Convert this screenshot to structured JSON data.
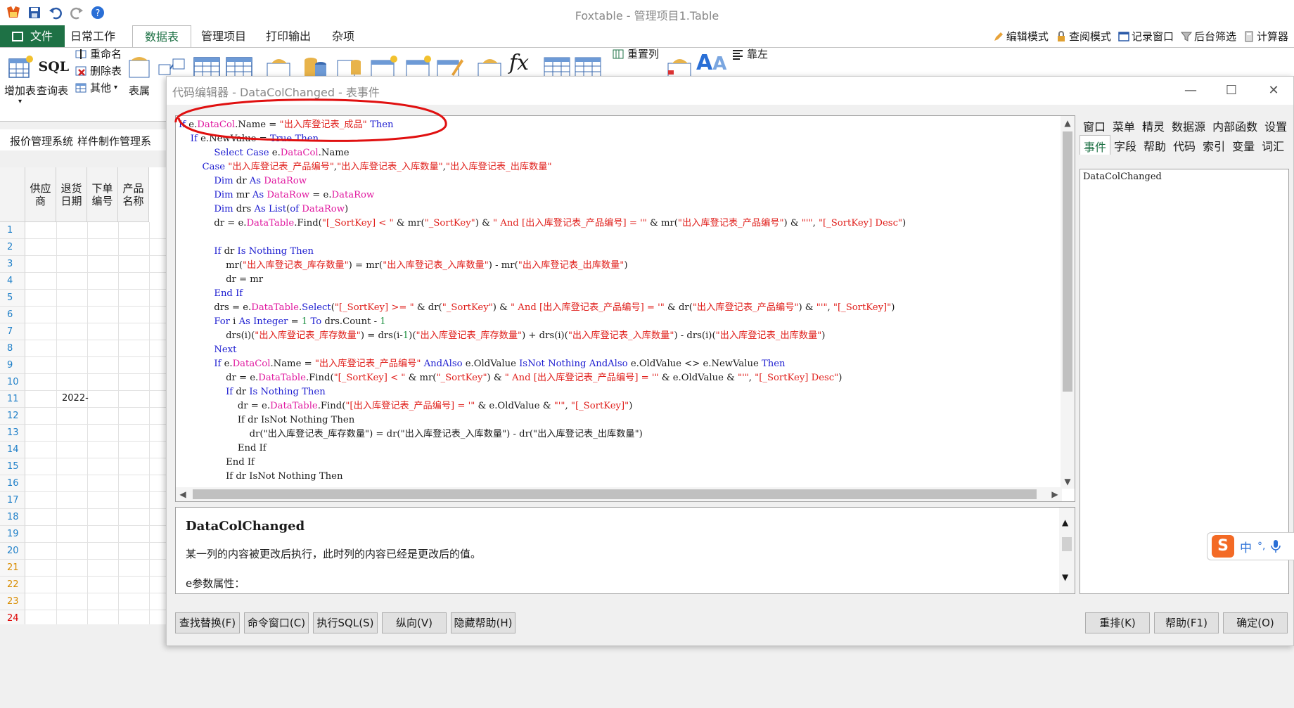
{
  "app": {
    "title": "Foxtable - 管理项目1.Table"
  },
  "ribbon_tabs": [
    "文件",
    "日常工作",
    "数据表",
    "管理项目",
    "打印输出",
    "杂项"
  ],
  "ribbon_right": [
    "编辑模式",
    "查阅模式",
    "记录窗口",
    "后台筛选",
    "计算器"
  ],
  "ribbon": {
    "add_table": "增加表",
    "query_table": "查询表",
    "sql_label": "SQL",
    "rename": "重命名",
    "delete_table": "删除表",
    "other": "其他",
    "table_prop": "表属",
    "rearrange_col": "重置列",
    "align_left": "靠左"
  },
  "sheet_tabs": [
    "报价管理系统",
    "样件制作管理系"
  ],
  "grid": {
    "headers": [
      "供应商",
      "退货日期",
      "下单编号",
      "产品名称"
    ],
    "rows": [
      "1",
      "2",
      "3",
      "4",
      "5",
      "6",
      "7",
      "8",
      "9",
      "10",
      "11",
      "12",
      "13",
      "14",
      "15",
      "16",
      "17",
      "18",
      "19",
      "20",
      "21",
      "22",
      "23",
      "24"
    ],
    "date_cell_row": 11,
    "date_cell_value": "2022-"
  },
  "editor": {
    "title": "代码编辑器 - DataColChanged - 表事件",
    "code_lines": [
      "If e.DataCol.Name = \"出入库登记表_成品\" Then",
      "    If e.NewValue = True Then",
      "            Select Case e.DataCol.Name",
      "        Case \"出入库登记表_产品编号\",\"出入库登记表_入库数量\",\"出入库登记表_出库数量\"",
      "            Dim dr As DataRow",
      "            Dim mr As DataRow = e.DataRow",
      "            Dim drs As List(of DataRow)",
      "            dr = e.DataTable.Find(\"[_SortKey] < \" & mr(\"_SortKey\") & \" And [出入库登记表_产品编号] = '\" & mr(\"出入库登记表_产品编号\") & \"'\", \"[_SortKey] Desc\")",
      "",
      "            If dr Is Nothing Then",
      "                mr(\"出入库登记表_库存数量\") = mr(\"出入库登记表_入库数量\") - mr(\"出入库登记表_出库数量\")",
      "                dr = mr",
      "            End If",
      "            drs = e.DataTable.Select(\"[_SortKey] >= \" & dr(\"_SortKey\") & \" And [出入库登记表_产品编号] = '\" & dr(\"出入库登记表_产品编号\") & \"'\", \"[_SortKey]\")",
      "            For i As Integer = 1 To drs.Count - 1",
      "                drs(i)(\"出入库登记表_库存数量\") = drs(i-1)(\"出入库登记表_库存数量\") + drs(i)(\"出入库登记表_入库数量\") - drs(i)(\"出入库登记表_出库数量\")",
      "            Next",
      "            If e.DataCol.Name = \"出入库登记表_产品编号\" AndAlso e.OldValue IsNot Nothing AndAlso e.OldValue <> e.NewValue Then",
      "                dr = e.DataTable.Find(\"[_SortKey] < \" & mr(\"_SortKey\") & \" And [出入库登记表_产品编号] = '\" & e.OldValue & \"'\", \"[_SortKey] Desc\")",
      "                If dr Is Nothing Then",
      "                    dr = e.DataTable.Find(\"[出入库登记表_产品编号] = '\" & e.OldValue & \"'\", \"[_SortKey]\")",
      "                    If dr IsNot Nothing Then",
      "                        dr(\"出入库登记表_库存数量\") = dr(\"出入库登记表_入库数量\") - dr(\"出入库登记表_出库数量\")",
      "                    End If",
      "                End If",
      "                If dr IsNot Nothing Then"
    ],
    "help": {
      "title": "DataColChanged",
      "desc": "某一列的内容被更改后执行，此时列的内容已经是更改后的值。",
      "props": "e参数属性："
    },
    "side_tabs_row1": [
      "窗口",
      "菜单",
      "精灵",
      "数据源",
      "内部函数",
      "设置"
    ],
    "side_tabs_row2": [
      "事件",
      "字段",
      "帮助",
      "代码",
      "索引",
      "变量",
      "词汇"
    ],
    "side_list": [
      "DataColChanged"
    ],
    "buttons_left": [
      "查找替换(F)",
      "命令窗口(C)",
      "执行SQL(S)",
      "纵向(V)",
      "隐藏帮助(H)"
    ],
    "buttons_right": [
      "重排(K)",
      "帮助(F1)",
      "确定(O)"
    ]
  },
  "ime": {
    "logo": "S",
    "lang": "中",
    "punct": "°,"
  },
  "colors": {
    "file_tab": "#1e7145",
    "keyword": "#1c1cd0",
    "string": "#e0201c",
    "type": "#e01aa0",
    "number": "#1c9040",
    "annotation": "#e01010"
  }
}
